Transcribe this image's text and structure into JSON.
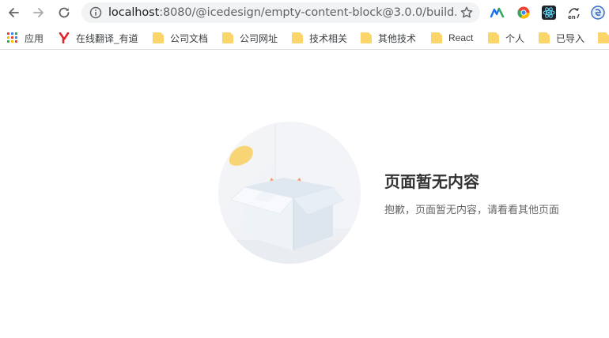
{
  "browser": {
    "url_host": "localhost",
    "url_rest": ":8080/@icedesign/empty-content-block@3.0.0/build..."
  },
  "bookmarks": [
    {
      "label": "应用",
      "icon": "apps-grid-icon"
    },
    {
      "label": "在线翻译_有道",
      "icon": "youdao-icon"
    },
    {
      "label": "公司文档",
      "icon": "folder-icon"
    },
    {
      "label": "公司网址",
      "icon": "folder-icon"
    },
    {
      "label": "技术相关",
      "icon": "folder-icon"
    },
    {
      "label": "其他技术",
      "icon": "folder-icon"
    },
    {
      "label": "React",
      "icon": "folder-icon"
    },
    {
      "label": "个人",
      "icon": "folder-icon"
    },
    {
      "label": "已导入",
      "icon": "folder-icon"
    }
  ],
  "extensions": [
    "medium-extension-icon",
    "chrome-colorful-extension-icon",
    "react-devtools-icon",
    "translate-extension-icon",
    "edge-extension-icon"
  ],
  "empty": {
    "title": "页面暂无内容",
    "description": "抱歉，页面暂无内容，请看看其他页面",
    "illustration": "cat-in-box-illustration"
  }
}
